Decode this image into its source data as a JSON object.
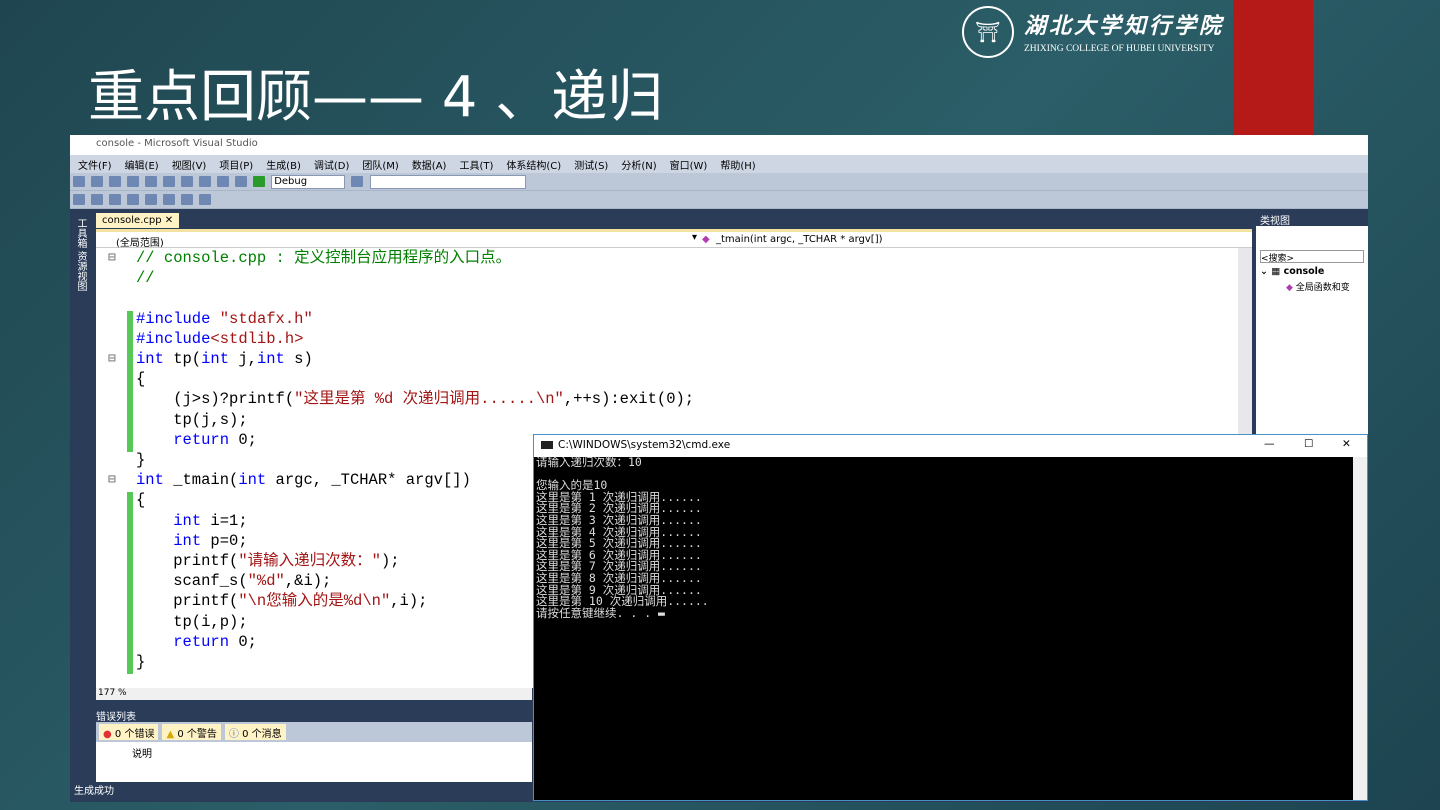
{
  "slide": {
    "title": "重点回顾—— 4 、递归",
    "logo_cn": "湖北大学知行学院",
    "logo_en": "ZHIXING COLLEGE OF HUBEI UNIVERSITY",
    "accent": "#b51a19"
  },
  "vs": {
    "window_title": "console - Microsoft Visual Studio",
    "menu": [
      "文件(F)",
      "编辑(E)",
      "视图(V)",
      "项目(P)",
      "生成(B)",
      "调试(D)",
      "团队(M)",
      "数据(A)",
      "工具(T)",
      "体系结构(C)",
      "测试(S)",
      "分析(N)",
      "窗口(W)",
      "帮助(H)"
    ],
    "config": "Debug",
    "side_tools": "工具箱  资源视图",
    "tab": "console.cpp",
    "tab_close": "✕",
    "scope": "(全局范围)",
    "function": "_tmain(int argc, _TCHAR * argv[])",
    "zoom": "177 %",
    "classview": {
      "title": "类视图",
      "search": "<搜索>",
      "root": "console",
      "child": "全局函数和变"
    },
    "errors": {
      "title": "错误列表",
      "errors": "0 个错误",
      "warnings": "0 个警告",
      "messages": "0 个消息",
      "column": "说明"
    },
    "status": "生成成功",
    "code": [
      {
        "fold": "⊟",
        "html": "<span class='cm'>// console.cpp : 定义控制台应用程序的入口点。</span>"
      },
      {
        "html": "<span class='cm'>//</span>"
      },
      {
        "html": ""
      },
      {
        "html": "<span class='pp'>#include</span> <span class='st'>\"stdafx.h\"</span>"
      },
      {
        "html": "<span class='pp'>#include</span><span class='st'>&lt;stdlib.h&gt;</span>"
      },
      {
        "fold": "⊟",
        "html": "<span class='kw'>int</span> tp(<span class='kw'>int</span> j,<span class='kw'>int</span> s)"
      },
      {
        "html": "{"
      },
      {
        "html": "    (j&gt;s)?printf(<span class='st'>\"这里是第 %d 次递归调用......\\n\"</span>,++s):exit(0);"
      },
      {
        "html": "    tp(j,s);"
      },
      {
        "html": "    <span class='kw'>return</span> 0;"
      },
      {
        "html": "}"
      },
      {
        "fold": "⊟",
        "html": "<span class='kw'>int</span> _tmain(<span class='kw'>int</span> argc, _TCHAR* argv[])"
      },
      {
        "html": "{"
      },
      {
        "html": "    <span class='kw'>int</span> i=1;"
      },
      {
        "html": "    <span class='kw'>int</span> p=0;"
      },
      {
        "html": "    printf(<span class='st'>\"请输入递归次数：\"</span>);"
      },
      {
        "html": "    scanf_s(<span class='st'>\"%d\"</span>,&amp;i);"
      },
      {
        "html": "    printf(<span class='st'>\"\\n您输入的是%d\\n\"</span>,i);"
      },
      {
        "html": "    tp(i,p);"
      },
      {
        "html": "    <span class='kw'>return</span> 0;"
      },
      {
        "html": "}"
      }
    ]
  },
  "cmd": {
    "title": "C:\\WINDOWS\\system32\\cmd.exe",
    "min": "—",
    "max": "☐",
    "close": "✕",
    "output": "请输入递归次数：10\n\n您输入的是10\n这里是第 1 次递归调用......\n这里是第 2 次递归调用......\n这里是第 3 次递归调用......\n这里是第 4 次递归调用......\n这里是第 5 次递归调用......\n这里是第 6 次递归调用......\n这里是第 7 次递归调用......\n这里是第 8 次递归调用......\n这里是第 9 次递归调用......\n这里是第 10 次递归调用......\n请按任意键继续. . . ▬"
  }
}
